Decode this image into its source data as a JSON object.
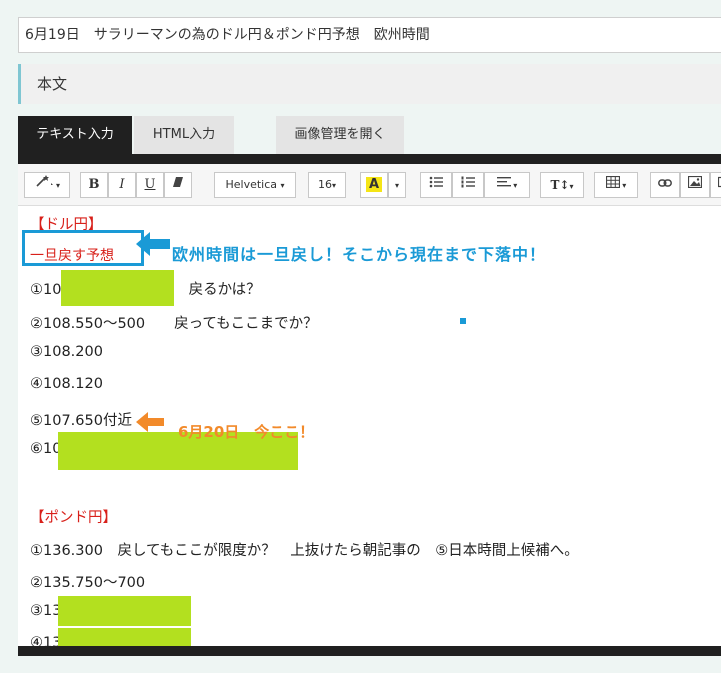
{
  "post": {
    "title": "6月19日　サラリーマンの為のドル円＆ポンド円予想　欧州時間"
  },
  "section": {
    "label": "本文"
  },
  "tabs": [
    {
      "label": "テキスト入力",
      "active": true
    },
    {
      "label": "HTML入力",
      "active": false
    },
    {
      "label": "画像管理を開く",
      "active": false
    }
  ],
  "toolbar": {
    "magic_icon": "magic-wand-icon",
    "bold": "B",
    "italic": "I",
    "underline": "U",
    "eraser_icon": "eraser-icon",
    "font": "Helvetica",
    "size": "16",
    "color_letter": "A",
    "text_height": "T↕",
    "colors": {
      "highlight": "#f5e516",
      "accent": "#1a9ad6"
    }
  },
  "body": {
    "usd_header": "【ドル円】",
    "usd_box": "一旦戻す予想",
    "usd_annotation": "欧州時間は一旦戻し！そこから現在まで下落中！",
    "usd_lines": [
      {
        "prefix": "①10",
        "suffix": "戻るかは？"
      },
      {
        "text": "②108.550～500　　戻ってもここまでか？"
      },
      {
        "text": "③108.200"
      },
      {
        "text": "④108.120"
      },
      {
        "text": "⑤107.650付近"
      },
      {
        "prefix": "⑥10"
      }
    ],
    "usd_note": "6月20日　今ここ！",
    "gbp_header": "【ポンド円】",
    "gbp_lines": [
      {
        "text": "①136.300　戻してもここが限度か？　上抜けたら朝記事の　⑤日本時間上候補へ。"
      },
      {
        "text": "②135.750～700"
      },
      {
        "prefix": "③13"
      },
      {
        "prefix": "④13"
      }
    ],
    "mask_color": "#b3e01f"
  }
}
